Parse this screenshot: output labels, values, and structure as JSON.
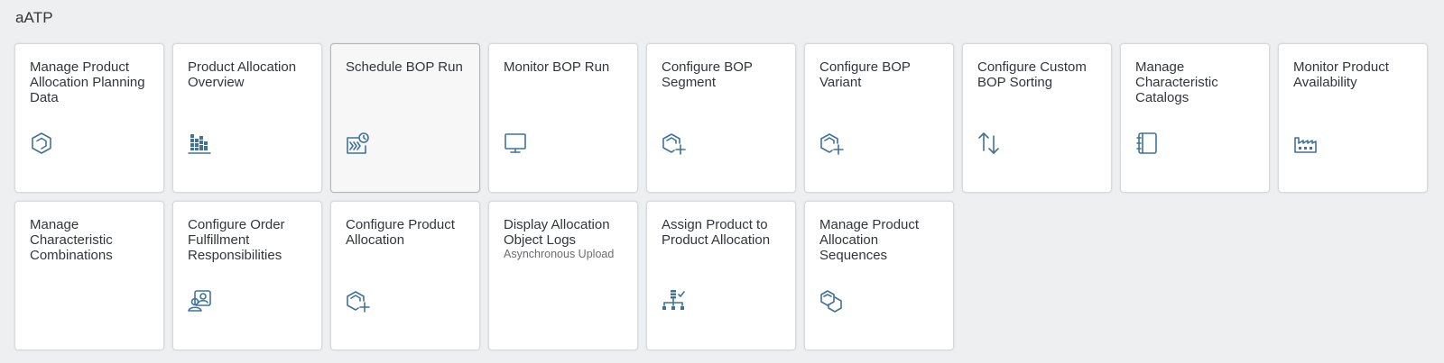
{
  "group": {
    "title": "aATP"
  },
  "tiles": [
    {
      "title": "Manage Product Allocation Planning Data",
      "subtitle": "",
      "icon": "product-cube-icon"
    },
    {
      "title": "Product Allocation Overview",
      "subtitle": "",
      "icon": "bar-chart-icon"
    },
    {
      "title": "Schedule BOP Run",
      "subtitle": "",
      "icon": "scheduled-run-icon"
    },
    {
      "title": "Monitor BOP Run",
      "subtitle": "",
      "icon": "monitor-icon"
    },
    {
      "title": "Configure BOP Segment",
      "subtitle": "",
      "icon": "add-product-icon"
    },
    {
      "title": "Configure BOP Variant",
      "subtitle": "",
      "icon": "add-product-icon"
    },
    {
      "title": "Configure Custom BOP Sorting",
      "subtitle": "",
      "icon": "sort-arrows-icon"
    },
    {
      "title": "Manage Characteristic Catalogs",
      "subtitle": "",
      "icon": "notebook-icon"
    },
    {
      "title": "Monitor Product Availability",
      "subtitle": "",
      "icon": "factory-icon"
    },
    {
      "title": "Manage Characteristic Combinations",
      "subtitle": "",
      "icon": ""
    },
    {
      "title": "Configure Order Fulfillment Responsibilities",
      "subtitle": "",
      "icon": "user-group-icon"
    },
    {
      "title": "Configure Product Allocation",
      "subtitle": "",
      "icon": "add-product-icon"
    },
    {
      "title": "Display Allocation Object Logs",
      "subtitle": "Asynchronous Upload",
      "icon": ""
    },
    {
      "title": "Assign Product to Product Allocation",
      "subtitle": "",
      "icon": "hierarchy-icon"
    },
    {
      "title": "Manage Product Allocation Sequences",
      "subtitle": "",
      "icon": "linked-cubes-icon"
    }
  ]
}
